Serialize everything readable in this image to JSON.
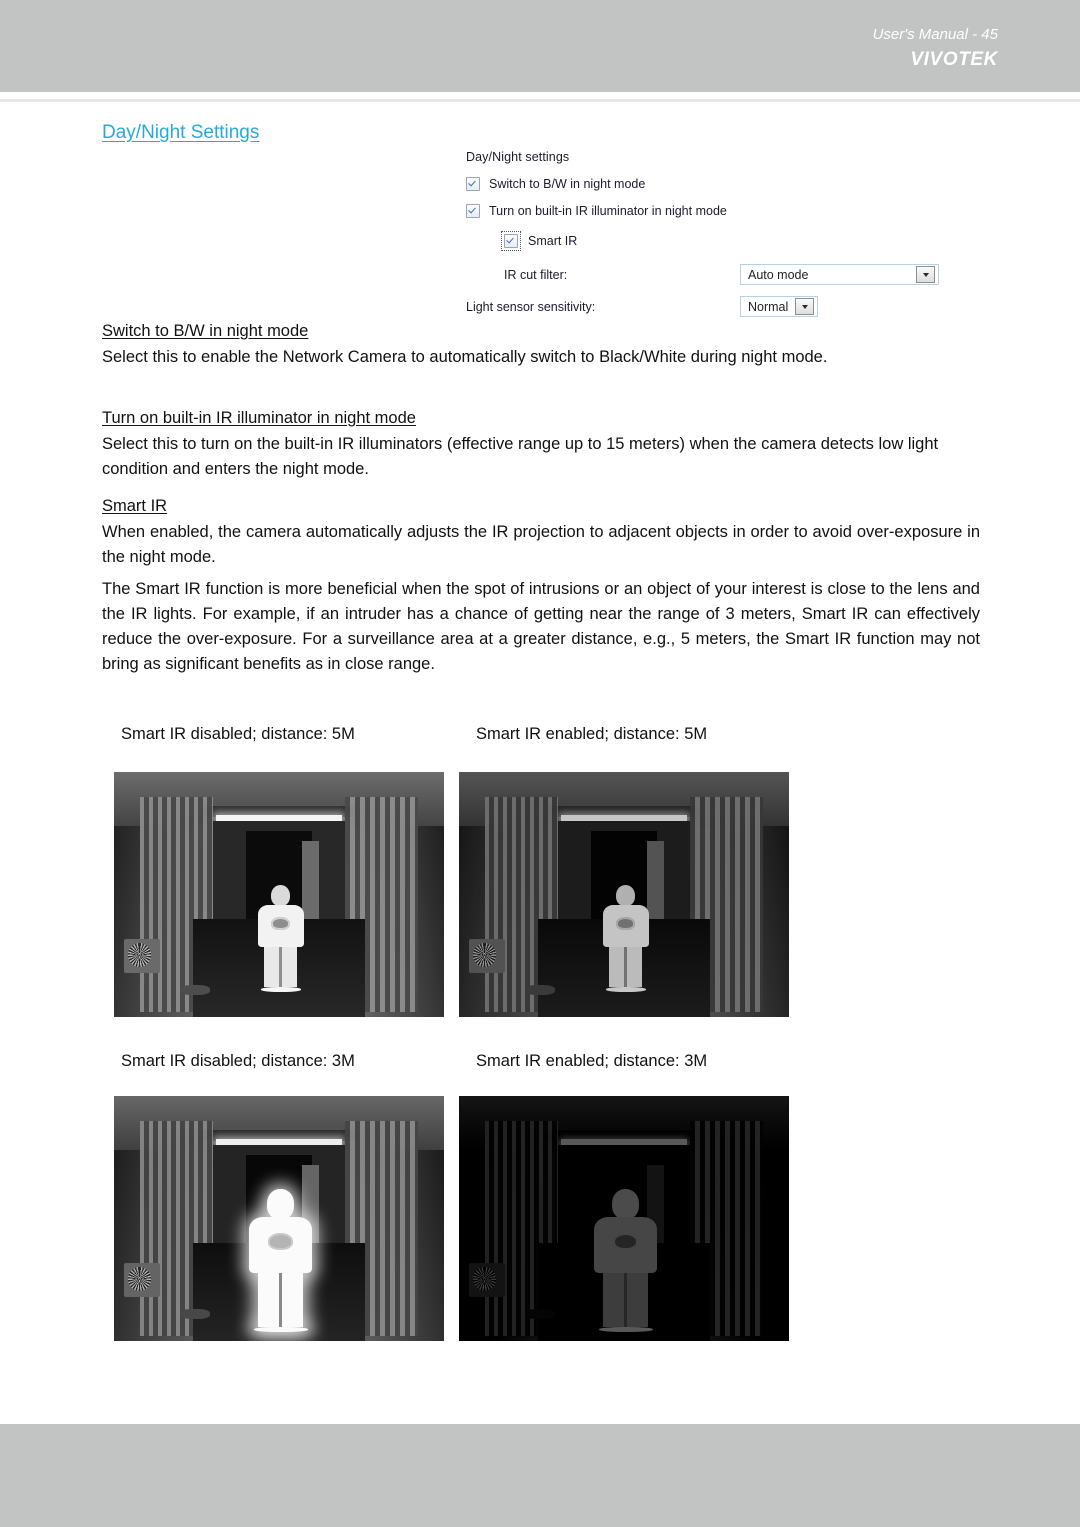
{
  "header": {
    "brand": "VIVOTEK"
  },
  "page_heading": "Day/Night Settings",
  "settings_panel": {
    "title": "Day/Night settings",
    "checkbox_bw": {
      "label": "Switch to B/W in night mode",
      "checked": true
    },
    "checkbox_ir": {
      "label": "Turn on built-in IR illuminator in night mode",
      "checked": true
    },
    "checkbox_smart_ir": {
      "label": "Smart IR",
      "checked": true
    },
    "ir_cut_filter": {
      "label": "IR cut filter:",
      "value": "Auto mode"
    },
    "light_sensor_sensitivity": {
      "label": "Light sensor sensitivity:",
      "value": "Normal"
    }
  },
  "sections": [
    {
      "heading": "Switch to B/W in night mode",
      "body": "Select this to enable the Network Camera to automatically switch to Black/White during night mode."
    },
    {
      "heading": "Turn on built-in IR illuminator in night mode",
      "body": "Select this to turn on the built-in IR illuminators (effective range up to 15 meters) when the camera detects low light condition and enters the night mode."
    },
    {
      "heading": "Smart IR",
      "body": "When enabled, the camera automatically adjusts the IR projection to adjacent objects in order to avoid over-exposure in the night mode."
    }
  ],
  "extra_paragraph": "The Smart IR function is more beneficial when the spot of intrusions or an object of your interest is close to the lens and the IR lights. For example, if an intruder has a chance of getting near the range of 3 meters, Smart IR can effectively reduce the over-exposure. For a surveillance area at a greater distance, e.g., 5 meters, the Smart IR function may not bring as significant benefits as in close range.",
  "figures": [
    {
      "caption": "Smart IR disabled; distance: 5M"
    },
    {
      "caption": "Smart IR enabled; distance: 5M"
    },
    {
      "caption": "Smart IR disabled; distance: 3M"
    },
    {
      "caption": "Smart IR enabled; distance: 3M"
    }
  ],
  "footer": {
    "text": "User's Manual - 45"
  },
  "colors": {
    "band_gray": "#c2c4c3",
    "heading_blue": "#29a8e0",
    "body_text": "#111111"
  }
}
